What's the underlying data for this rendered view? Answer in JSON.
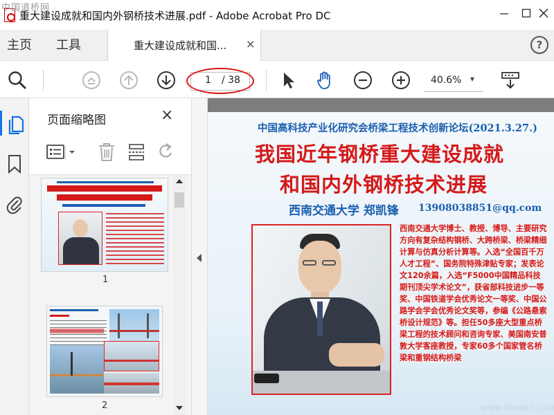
{
  "window": {
    "watermark": "中国道桥网",
    "title": "重大建设成就和国内外钢桥技术进展.pdf - Adobe Acrobat Pro DC"
  },
  "tabs": {
    "home": "主页",
    "tools": "工具",
    "document": "重大建设成就和国...",
    "close_glyph": "×",
    "help_glyph": "?"
  },
  "toolbar": {
    "current_page": "1",
    "total_pages": "/ 38",
    "zoom": "40.6%",
    "zoom_caret": "▾"
  },
  "sidebar": {
    "panel_title": "页面缩略图",
    "close_glyph": "×",
    "thumbnails": [
      {
        "label": "1"
      },
      {
        "label": "2"
      }
    ]
  },
  "document": {
    "subtitle": "中国高科技产业化研究会桥梁工程技术创新论坛(2021.3.27.)",
    "title_line1": "我国近年钢桥重大建设成就",
    "title_line2": "和国内外钢桥技术进展",
    "author": "西南交通大学  郑凯锋",
    "email": "13908038851@qq.com",
    "bio": "西南交通大学博士、教授、博导、主要研究方向有复杂结构钢桥、大跨桥梁、桥梁精细计算与仿真分析计算等。入选“全国百千万人才工程”、国务院特殊津贴专家；发表论文120余篇，入选“F5000中国精品科技期刊顶尖学术论文”，获省部科技进步一等奖、中国铁道学会优秀论文一等奖、中国公路学会学会优秀论文奖等，参编《公路悬索桥设计规范》等。担任50多座大型重点桥梁工程的技术顾问和咨询专家、美国南安普敦大学客座教授，专家60多个国家管名桥梁和重钢结构桥梁",
    "watermark": "www.doooan.com"
  },
  "colors": {
    "accent": "#1473e6",
    "doc_title_red": "#d41a1a",
    "doc_blue": "#1a5fb0",
    "annotation_red": "#e01010"
  }
}
